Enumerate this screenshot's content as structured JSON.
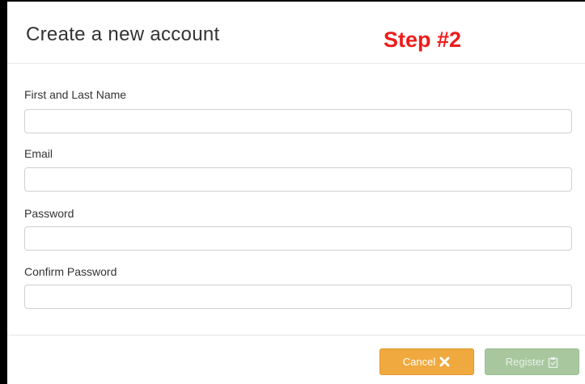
{
  "modal": {
    "title": "Create a new account",
    "annotation": "Step #2"
  },
  "form": {
    "fields": [
      {
        "label": "First and Last Name",
        "value": "",
        "placeholder": ""
      },
      {
        "label": "Email",
        "value": "",
        "placeholder": ""
      },
      {
        "label": "Password",
        "value": "",
        "placeholder": ""
      },
      {
        "label": "Confirm Password",
        "value": "",
        "placeholder": ""
      }
    ]
  },
  "footer": {
    "cancel_label": "Cancel",
    "cancel_icon": "close-x-icon",
    "register_label": "Register",
    "register_icon": "clipboard-icon"
  },
  "colors": {
    "annotation": "#ee1c1c",
    "cancel_button": "#f0a93e",
    "register_button": "#a8c79f"
  }
}
